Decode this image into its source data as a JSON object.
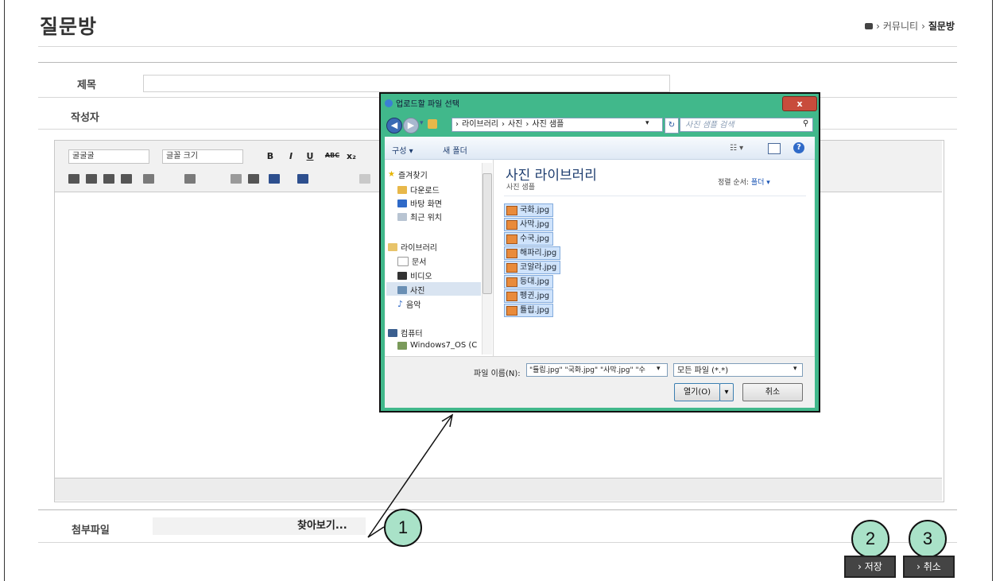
{
  "page": {
    "title": "질문방",
    "breadcrumb": [
      "커뮤니티",
      "질문방"
    ]
  },
  "form": {
    "subject_label": "제목",
    "author_label": "작성자",
    "attach_label": "첨부파일",
    "browse_label": "찾아보기..."
  },
  "editor": {
    "font_family": "굴굴굴",
    "font_size": "글꼴 크기",
    "buttons": [
      "B",
      "I",
      "U",
      "ABC",
      "x₂"
    ]
  },
  "actions": {
    "save_label": "› 저장",
    "cancel_label": "› 취소"
  },
  "annotations": [
    "1",
    "2",
    "3"
  ],
  "dialog": {
    "title": "업로드할 파일 선택",
    "close": "x",
    "address": [
      "라이브러리",
      "사진",
      "사진 샘플"
    ],
    "search_placeholder": "사진 샘플 검색",
    "toolbar": {
      "organize": "구성 ▾",
      "new_folder": "새 폴더"
    },
    "nav": {
      "favorites": "즐겨찾기",
      "downloads": "다운로드",
      "desktop": "바탕 화면",
      "recent": "최근 위치",
      "libraries": "라이브러리",
      "documents": "문서",
      "videos": "비디오",
      "pictures": "사진",
      "music": "음악",
      "computer": "컴퓨터",
      "drive": "Windows7_OS (C"
    },
    "library_title": "사진 라이브러리",
    "library_sub": "사진 샘플",
    "sort_label": "정렬 순서:",
    "sort_value": "폴더 ▾",
    "files": [
      "국화.jpg",
      "사막.jpg",
      "수국.jpg",
      "해파리.jpg",
      "코알라.jpg",
      "등대.jpg",
      "펭귄.jpg",
      "튤립.jpg"
    ],
    "filename_label": "파일 이름(N):",
    "filename_value": "\"튤립.jpg\" \"국화.jpg\" \"사막.jpg\" \"수",
    "filetype": "모든 파일 (*.*)",
    "open_label": "열기(O)",
    "cancel_label": "취소"
  }
}
